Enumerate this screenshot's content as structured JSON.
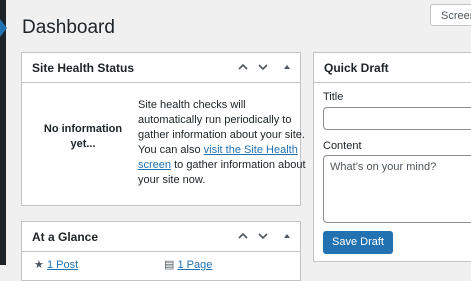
{
  "header": {
    "page_title": "Dashboard",
    "screen_options_label": "Screen"
  },
  "site_health": {
    "title": "Site Health Status",
    "empty_label": "No information yet...",
    "description_prefix": "Site health checks will automatically run periodically to gather information about your site. You can also ",
    "link_label": "visit the Site Health screen",
    "description_suffix": " to gather information about your site now."
  },
  "at_a_glance": {
    "title": "At a Glance",
    "posts_label": "1 Post",
    "pages_label": "1 Page"
  },
  "quick_draft": {
    "title": "Quick Draft",
    "title_label": "Title",
    "title_value": "",
    "content_label": "Content",
    "content_placeholder": "What’s on your mind?",
    "save_label": "Save Draft"
  },
  "colors": {
    "accent": "#2271b1",
    "sidebar": "#1d2327",
    "background": "#f0f0f1"
  }
}
